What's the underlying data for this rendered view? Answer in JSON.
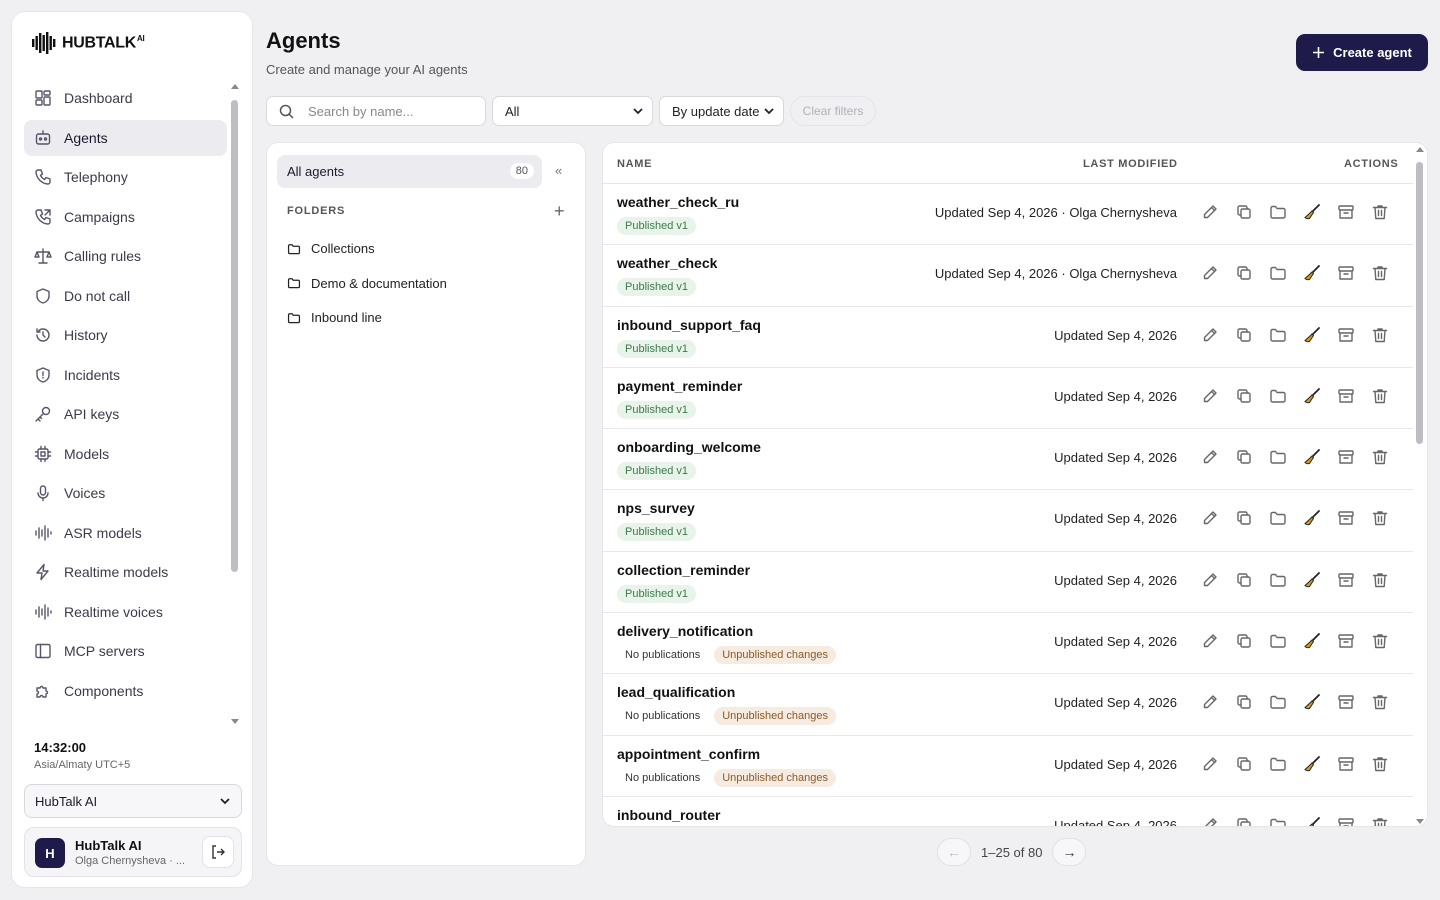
{
  "brand": {
    "name": "HUBTALK",
    "suffix": "AI"
  },
  "sidebar": {
    "items": [
      {
        "label": "Dashboard",
        "icon": "dashboard-icon"
      },
      {
        "label": "Agents",
        "icon": "robot-icon",
        "active": true
      },
      {
        "label": "Telephony",
        "icon": "phone-icon"
      },
      {
        "label": "Campaigns",
        "icon": "phone-outgoing-icon"
      },
      {
        "label": "Calling rules",
        "icon": "scales-icon"
      },
      {
        "label": "Do not call",
        "icon": "shield-icon"
      },
      {
        "label": "History",
        "icon": "history-icon"
      },
      {
        "label": "Incidents",
        "icon": "shield-alert-icon"
      },
      {
        "label": "API keys",
        "icon": "key-icon"
      },
      {
        "label": "Models",
        "icon": "cpu-icon"
      },
      {
        "label": "Voices",
        "icon": "mic-icon"
      },
      {
        "label": "ASR models",
        "icon": "waveform-icon"
      },
      {
        "label": "Realtime models",
        "icon": "lightning-icon"
      },
      {
        "label": "Realtime voices",
        "icon": "waveform-icon"
      },
      {
        "label": "MCP servers",
        "icon": "panel-icon"
      },
      {
        "label": "Components",
        "icon": "puzzle-icon"
      }
    ],
    "clock": "14:32:00",
    "timezone": "Asia/Almaty UTC+5",
    "org_select": "HubTalk AI",
    "user": {
      "initial": "H",
      "name": "HubTalk AI",
      "sub": "Olga Chernysheva · ..."
    }
  },
  "header": {
    "title": "Agents",
    "subtitle": "Create and manage your AI agents",
    "create_label": "Create agent"
  },
  "filters": {
    "search_placeholder": "Search by name...",
    "status_value": "All",
    "sort_value": "By update date",
    "clear_label": "Clear filters"
  },
  "folders": {
    "all_label": "All agents",
    "all_count": "80",
    "collapse_glyph": "«",
    "section_label": "FOLDERS",
    "add_glyph": "+",
    "items": [
      "Collections",
      "Demo & documentation",
      "Inbound line"
    ]
  },
  "table": {
    "headers": {
      "name": "NAME",
      "modified": "LAST MODIFIED",
      "actions": "ACTIONS"
    },
    "rows": [
      {
        "name": "weather_check_ru",
        "badges": [
          {
            "text": "Published v1",
            "kind": "pub"
          }
        ],
        "modified": "Updated Sep 4, 2026 · Olga Chernysheva"
      },
      {
        "name": "weather_check",
        "badges": [
          {
            "text": "Published v1",
            "kind": "pub"
          }
        ],
        "modified": "Updated Sep 4, 2026 · Olga Chernysheva"
      },
      {
        "name": "inbound_support_faq",
        "badges": [
          {
            "text": "Published v1",
            "kind": "pub"
          }
        ],
        "modified": "Updated Sep 4, 2026"
      },
      {
        "name": "payment_reminder",
        "badges": [
          {
            "text": "Published v1",
            "kind": "pub"
          }
        ],
        "modified": "Updated Sep 4, 2026"
      },
      {
        "name": "onboarding_welcome",
        "badges": [
          {
            "text": "Published v1",
            "kind": "pub"
          }
        ],
        "modified": "Updated Sep 4, 2026"
      },
      {
        "name": "nps_survey",
        "badges": [
          {
            "text": "Published v1",
            "kind": "pub"
          }
        ],
        "modified": "Updated Sep 4, 2026"
      },
      {
        "name": "collection_reminder",
        "badges": [
          {
            "text": "Published v1",
            "kind": "pub"
          }
        ],
        "modified": "Updated Sep 4, 2026"
      },
      {
        "name": "delivery_notification",
        "badges": [
          {
            "text": "No publications",
            "kind": "none"
          },
          {
            "text": "Unpublished changes",
            "kind": "unpub"
          }
        ],
        "modified": "Updated Sep 4, 2026"
      },
      {
        "name": "lead_qualification",
        "badges": [
          {
            "text": "No publications",
            "kind": "none"
          },
          {
            "text": "Unpublished changes",
            "kind": "unpub"
          }
        ],
        "modified": "Updated Sep 4, 2026"
      },
      {
        "name": "appointment_confirm",
        "badges": [
          {
            "text": "No publications",
            "kind": "none"
          },
          {
            "text": "Unpublished changes",
            "kind": "unpub"
          }
        ],
        "modified": "Updated Sep 4, 2026"
      },
      {
        "name": "inbound_router",
        "badges": [],
        "modified": "Updated Sep 4, 2026"
      }
    ],
    "actions": [
      "edit-icon",
      "copy-icon",
      "folder-icon",
      "broom-icon",
      "archive-icon",
      "trash-icon"
    ]
  },
  "pagination": {
    "prev": "←",
    "range": "1–25 of 80",
    "next": "→"
  },
  "colors": {
    "accent": "#1e1b4b",
    "published_bg": "#e8f3ea",
    "unpublished_bg": "#f5ebe0",
    "broom": "#d89a1f"
  }
}
